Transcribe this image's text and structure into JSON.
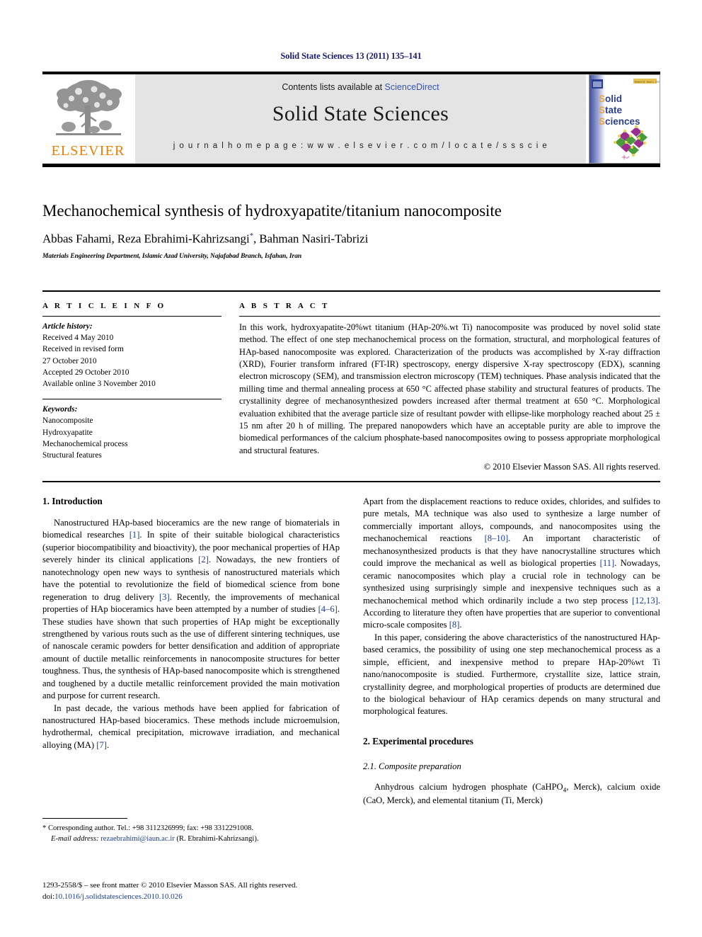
{
  "running_head": "Solid State Sciences 13 (2011) 135–141",
  "masthead": {
    "publisher_name": "ELSEVIER",
    "contents_prefix": "Contents lists available at ",
    "contents_link": "ScienceDirect",
    "journal_title": "Solid State Sciences",
    "homepage": "j o u r n a l   h o m e p a g e :   w w w . e l s e v i e r . c o m / l o c a t e / s s s c i e",
    "cover": {
      "line1": "Solid",
      "line2": "State",
      "line3": "Sciences",
      "badge": "Volume 13 . Issue 1 . January 2011",
      "accent_blue": "#2b3d8f",
      "accent_orange": "#e8a33d"
    }
  },
  "article": {
    "title": "Mechanochemical synthesis of hydroxyapatite/titanium nanocomposite",
    "authors": "Abbas Fahami, Reza Ebrahimi-Kahrizsangi",
    "authors_tail": ", Bahman Nasiri-Tabrizi",
    "author_marker": "*",
    "affiliation": "Materials Engineering Department, Islamic Azad University, Najafabad Branch, Isfahan, Iran"
  },
  "info": {
    "label": "A R T I C L E   I N F O",
    "history_label": "Article history:",
    "history": [
      "Received 4 May 2010",
      "Received in revised form",
      "27 October 2010",
      "Accepted 29 October 2010",
      "Available online 3 November 2010"
    ],
    "keywords_label": "Keywords:",
    "keywords": [
      "Nanocomposite",
      "Hydroxyapatite",
      "Mechanochemical process",
      "Structural features"
    ]
  },
  "abstract": {
    "label": "A B S T R A C T",
    "text": "In this work, hydroxyapatite-20%wt titanium (HAp-20%.wt Ti) nanocomposite was produced by novel solid state method. The effect of one step mechanochemical process on the formation, structural, and morphological features of HAp-based nanocomposite was explored. Characterization of the products was accomplished by X-ray diffraction (XRD), Fourier transform infrared (FT-IR) spectroscopy, energy dispersive X-ray spectroscopy (EDX), scanning electron microscopy (SEM), and transmission electron microscopy (TEM) techniques. Phase analysis indicated that the milling time and thermal annealing process at 650 °C affected phase stability and structural features of products. The crystallinity degree of mechanosynthesized powders increased after thermal treatment at 650 °C. Morphological evaluation exhibited that the average particle size of resultant powder with ellipse-like morphology reached about 25 ± 15 nm after 20 h of milling. The prepared nanopowders which have an acceptable purity are able to improve the biomedical performances of the calcium phosphate-based nanocomposites owing to possess appropriate morphological and structural features.",
    "copyright": "© 2010 Elsevier Masson SAS. All rights reserved."
  },
  "sections": {
    "introduction_heading": "1.  Introduction",
    "experimental_heading": "2.  Experimental procedures",
    "composite_prep_heading": "2.1.  Composite preparation"
  },
  "left_column": {
    "p1_a": "Nanostructured HAp-based bioceramics are the new range of biomaterials in biomedical researches ",
    "p1_r1": "[1]",
    "p1_b": ". In spite of their suitable biological characteristics (superior biocompatibility and bioactivity), the poor mechanical properties of HAp severely hinder its clinical applications ",
    "p1_r2": "[2]",
    "p1_c": ". Nowadays, the new frontiers of nanotechnology open new ways to synthesis of nanostructured materials which have the potential to revolutionize the field of biomedical science from bone regeneration to drug delivery ",
    "p1_r3": "[3]",
    "p1_d": ". Recently, the improvements of mechanical properties of HAp bioceramics have been attempted by a number of studies ",
    "p1_r4": "[4–6]",
    "p1_e": ". These studies have shown that such properties of HAp might be exceptionally strengthened by various routs such as the use of different sintering techniques, use of nanoscale ceramic powders for better densification and addition of appropriate amount of ductile metallic reinforcements in nanocomposite structures for better toughness. Thus, the synthesis of HAp-based nanocomposite which is strengthened and toughened by a ductile metallic reinforcement provided the main motivation and purpose for current research.",
    "p2_a": "In past decade, the various methods have been applied for fabrication of nanostructured HAp-based bioceramics. These methods include microemulsion, hydrothermal, chemical precipitation, microwave irradiation, and mechanical alloying (MA) ",
    "p2_r1": "[7]",
    "p2_b": "."
  },
  "right_column": {
    "p1_a": "Apart from the displacement reactions to reduce oxides, chlorides, and sulfides to pure metals, MA technique was also used to synthesize a large number of commercially important alloys, compounds, and nanocomposites using the mechanochemical reactions ",
    "p1_r1": "[8–10]",
    "p1_b": ". An important characteristic of mechanosynthesized products is that they have nanocrystalline structures which could improve the mechanical as well as biological properties ",
    "p1_r2": "[11]",
    "p1_c": ". Nowadays, ceramic nanocomposites which play a crucial role in technology can be synthesized using surprisingly simple and inexpensive techniques such as a mechanochemical method which ordinarily include a two step process ",
    "p1_r3": "[12,13]",
    "p1_d": ". According to literature they often have properties that are superior to conventional micro-scale composites ",
    "p1_r4": "[8]",
    "p1_e": ".",
    "p2": "In this paper, considering the above characteristics of the nanostructured HAp-based ceramics, the possibility of using one step mechanochemical process as a simple, efficient, and inexpensive method to prepare HAp-20%wt Ti nano/nanocomposite is studied. Furthermore, crystallite size, lattice strain, crystallinity degree, and morphological properties of products are determined due to the biological behaviour of HAp ceramics depends on many structural and morphological features.",
    "p3_a": "Anhydrous calcium hydrogen phosphate (CaHPO",
    "p3_sub": "4",
    "p3_b": ", Merck), calcium oxide (CaO, Merck), and elemental titanium (Ti, Merck)"
  },
  "footnote": {
    "corresponding": "* Corresponding author. Tel.: +98 3112326999; fax: +98 3312291008.",
    "email_label": "E-mail address:",
    "email": "rezaebrahimi@iaun.ac.ir",
    "email_owner": "(R. Ebrahimi-Kahrizsangi)."
  },
  "imprint": {
    "issn_line": "1293-2558/$ – see front matter © 2010 Elsevier Masson SAS. All rights reserved.",
    "doi_label": "doi:",
    "doi": "10.1016/j.solidstatesciences.2010.10.026"
  }
}
